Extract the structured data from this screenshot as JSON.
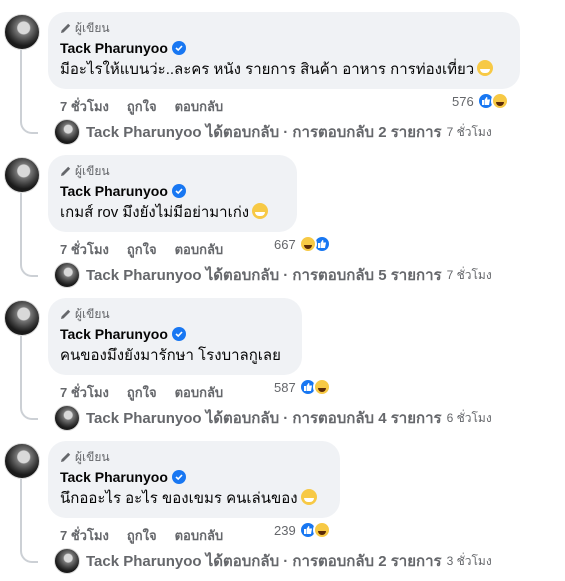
{
  "comments": [
    {
      "author_badge": "ผู้เขียน",
      "name": "Tack Pharunyoo",
      "text": "มีอะไรให้แบนว่ะ..ละคร หนัง รายการ สินค้า อาหาร การท่องเที่ยว",
      "time": "7 ชั่วโมง",
      "like": "ถูกใจ",
      "reply": "ตอบกลับ",
      "reaction_count": "576",
      "reply_summary": "Tack Pharunyoo ได้ตอบกลับ · การตอบกลับ 2 รายการ",
      "reply_time": "7 ชั่วโมง"
    },
    {
      "author_badge": "ผู้เขียน",
      "name": "Tack Pharunyoo",
      "text": "เกมส์ rov มึงยังไม่มีอย่ามาเก่ง",
      "time": "7 ชั่วโมง",
      "like": "ถูกใจ",
      "reply": "ตอบกลับ",
      "reaction_count": "667",
      "reply_summary": "Tack Pharunyoo ได้ตอบกลับ · การตอบกลับ 5 รายการ",
      "reply_time": "7 ชั่วโมง"
    },
    {
      "author_badge": "ผู้เขียน",
      "name": "Tack Pharunyoo",
      "text": "คนของมึงยังมารักษา โรงบาลกูเลย",
      "time": "7 ชั่วโมง",
      "like": "ถูกใจ",
      "reply": "ตอบกลับ",
      "reaction_count": "587",
      "reply_summary": "Tack Pharunyoo ได้ตอบกลับ · การตอบกลับ 4 รายการ",
      "reply_time": "6 ชั่วโมง"
    },
    {
      "author_badge": "ผู้เขียน",
      "name": "Tack Pharunyoo",
      "text": "นึกออะไร อะไร ของเขมร คนเล่นของ",
      "time": "7 ชั่วโมง",
      "like": "ถูกใจ",
      "reply": "ตอบกลับ",
      "reaction_count": "239",
      "reply_summary": "Tack Pharunyoo ได้ตอบกลับ · การตอบกลับ 2 รายการ",
      "reply_time": "3 ชั่วโมง"
    }
  ],
  "colors": {
    "accent": "#1877f2",
    "bubble": "#f0f2f5",
    "meta": "#65676b"
  },
  "icons": [
    "pencil-icon",
    "verified-icon",
    "like-reaction-icon",
    "haha-reaction-icon",
    "grin-emoji-icon"
  ]
}
